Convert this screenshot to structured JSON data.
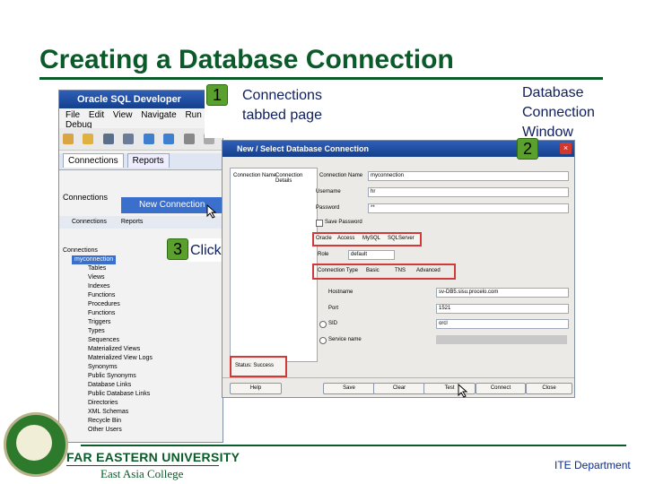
{
  "slide": {
    "title": "Creating a Database Connection",
    "footer": {
      "university": "FAR EASTERN UNIVERSITY",
      "college": "East Asia College",
      "department": "ITE Department"
    }
  },
  "callouts": [
    {
      "number": "1",
      "text_lines": [
        "Connections",
        "tabbed page"
      ]
    },
    {
      "number": "2",
      "text_lines": [
        "Database",
        "Connection",
        "Window"
      ]
    },
    {
      "number": "3",
      "text_lines": [
        "Click to test"
      ]
    }
  ],
  "sqldev": {
    "title": "Oracle SQL Developer",
    "menu": [
      "File",
      "Edit",
      "View",
      "Navigate",
      "Run",
      "Debug"
    ],
    "tabs": [
      "Connections",
      "Reports"
    ],
    "connections_label": "Connections",
    "popup_item": "New Connection",
    "tree_root": "Connections",
    "tree_connection": "myconnection",
    "tree_items": [
      "Tables",
      "Views",
      "Indexes",
      "Functions",
      "Procedures",
      "Functions",
      "Triggers",
      "Types",
      "Sequences",
      "Materialized Views",
      "Materialized View Logs",
      "Synonyms",
      "Public Synonyms",
      "Database Links",
      "Public Database Links",
      "Directories",
      "XML Schemas",
      "Recycle Bin",
      "Other Users"
    ],
    "icon_colors": [
      "#d9a441",
      "#3f7fd0",
      "#5aa02c",
      "#c0392b",
      "#8e5bb5",
      "#d9a441",
      "#3f7fd0"
    ]
  },
  "dialog": {
    "title": "New / Select Database Connection",
    "close_glyph": "×",
    "connection_name_label": "Connection Name",
    "connection_name_value": "myconnection",
    "username_label": "Username",
    "username_value": "hr",
    "password_label": "Password",
    "password_value": "**",
    "save_password_label": "Save Password",
    "db_tabs": [
      "Oracle",
      "Access",
      "MySQL",
      "SQLServer"
    ],
    "role_label": "Role",
    "role_value": "default",
    "connection_type_label": "Connection Type",
    "connection_types": [
      "Basic",
      "TNS",
      "Advanced"
    ],
    "hostname_label": "Hostname",
    "hostname_value": "sv-DB5.sisu.procelo.com",
    "port_label": "Port",
    "port_value": "1521",
    "sid_label": "SID",
    "sid_value": "orcl",
    "service_name_label": "Service name",
    "status": "Status: Success",
    "list_headers": [
      "Connection Name",
      "Connection Details"
    ],
    "buttons": [
      "Help",
      "Save",
      "Clear",
      "Test",
      "Connect",
      "Close"
    ]
  },
  "colors": {
    "title_green": "#0b5a2a",
    "callout_green": "#5aa02c",
    "highlight_red": "#d23a3a",
    "titlebar_blue": "#2e5fb8"
  }
}
